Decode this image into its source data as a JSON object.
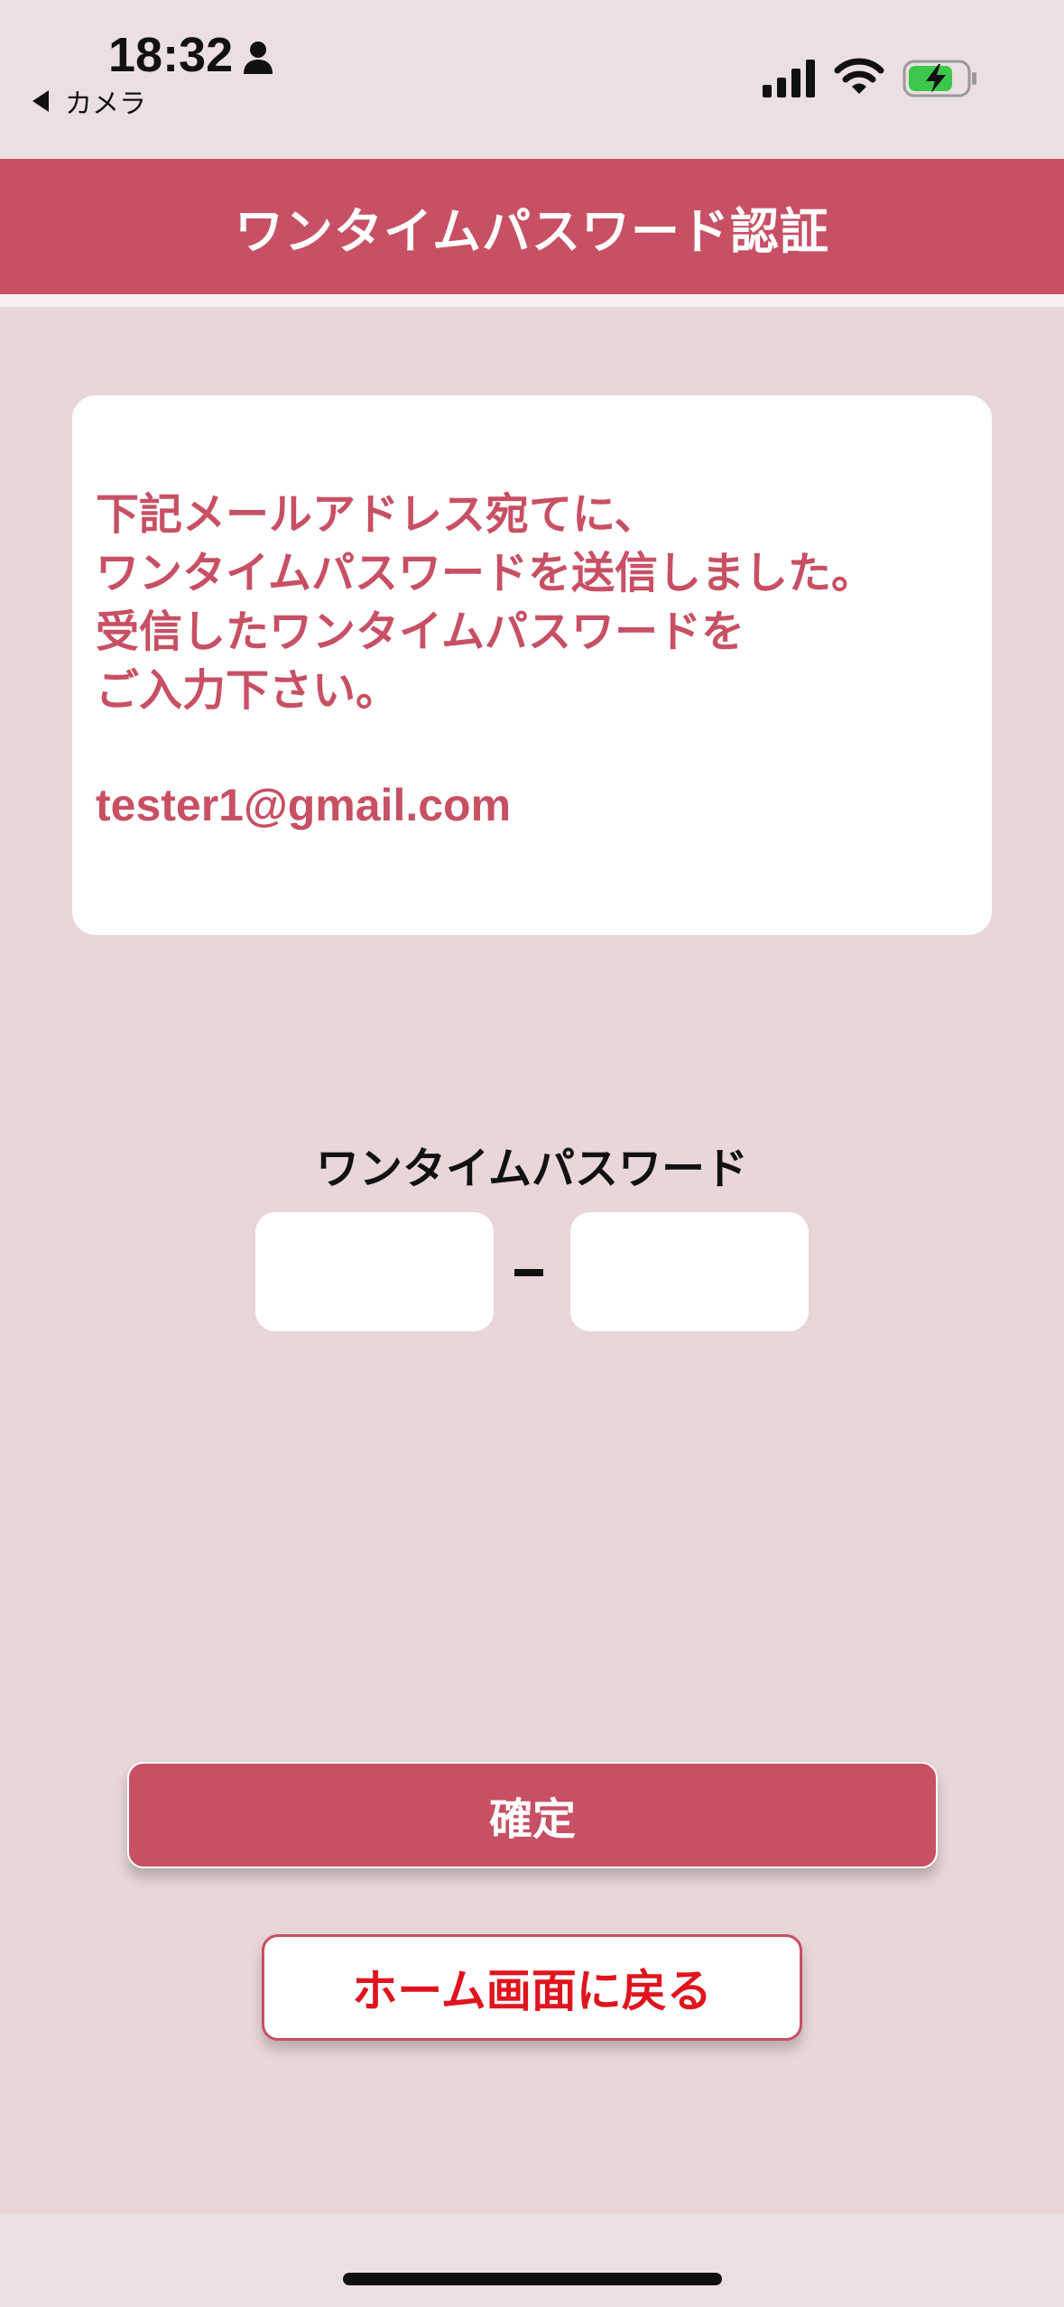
{
  "status_bar": {
    "time": "18:32",
    "back_app": "カメラ"
  },
  "header": {
    "title": "ワンタイムパスワード認証"
  },
  "info": {
    "lines": [
      "下記メールアドレス宛てに、",
      "ワンタイムパスワードを送信しました。",
      "受信したワンタイムパスワードを",
      "ご入力下さい。"
    ],
    "email": "tester1@gmail.com"
  },
  "otp": {
    "label": "ワンタイムパスワード",
    "field1_value": "",
    "field2_value": "",
    "separator": "-"
  },
  "buttons": {
    "confirm": "確定",
    "home": "ホーム画面に戻る"
  },
  "colors": {
    "accent": "#c85064",
    "background": "#e8d6d9",
    "home_text": "#e0141e"
  }
}
